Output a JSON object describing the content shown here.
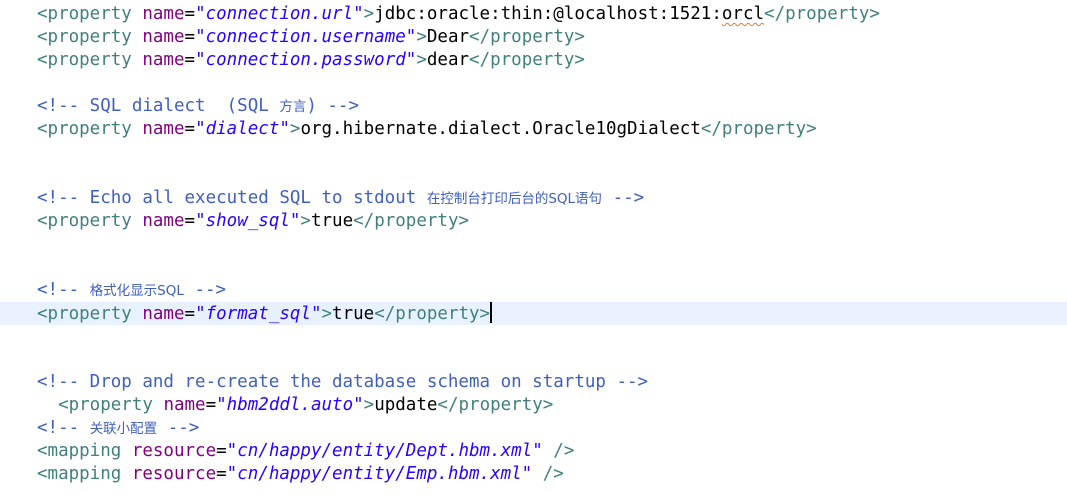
{
  "colors": {
    "tag": "#3f7f7f",
    "attribute": "#7f007f",
    "value": "#2a00ff",
    "text": "#000000",
    "comment": "#3f5fbf",
    "current_line": "#e8f2fe"
  },
  "lines": {
    "l1": {
      "open": "<property ",
      "attr": "name",
      "eq": "=",
      "value": "\"connection.url\"",
      "gt": ">",
      "text_a": "jdbc:oracle:thin:@localhost:1521:",
      "text_b": "orcl",
      "close": "</property>"
    },
    "l2": {
      "open": "<property ",
      "attr": "name",
      "eq": "=",
      "value": "\"connection.username\"",
      "gt": ">",
      "text": "Dear",
      "close": "</property>"
    },
    "l3": {
      "open": "<property ",
      "attr": "name",
      "eq": "=",
      "value": "\"connection.password\"",
      "gt": ">",
      "text": "dear",
      "close": "</property>"
    },
    "l4": {
      "comment": "<!-- SQL dialect  (SQL ",
      "cjk": "方言",
      "comment_end": ") -->"
    },
    "l5": {
      "open": "<property ",
      "attr": "name",
      "eq": "=",
      "value": "\"dialect\"",
      "gt": ">",
      "text": "org.hibernate.dialect.Oracle10gDialect",
      "close": "</property>"
    },
    "l6": {
      "comment": "<!-- Echo all executed SQL to stdout ",
      "cjk": "在控制台打印后台的SQL语句",
      "comment_end": " -->"
    },
    "l7": {
      "open": "<property ",
      "attr": "name",
      "eq": "=",
      "value": "\"show_sql\"",
      "gt": ">",
      "text": "true",
      "close": "</property>"
    },
    "l8": {
      "comment": "<!-- ",
      "cjk": "格式化显示SQL",
      "comment_end": " -->"
    },
    "l9": {
      "open": "<property ",
      "attr": "name",
      "eq": "=",
      "value": "\"format_sql\"",
      "gt": ">",
      "text": "true",
      "close": "</property>"
    },
    "l10": {
      "comment": "<!-- Drop and re-create the database schema on startup -->"
    },
    "l11": {
      "open": "  <property ",
      "attr": "name",
      "eq": "=",
      "value": "\"hbm2ddl.auto\"",
      "gt": ">",
      "text": "update",
      "close": "</property>"
    },
    "l12": {
      "comment": "<!-- ",
      "cjk": "关联小配置",
      "comment_end": " -->"
    },
    "l13": {
      "open": "<mapping ",
      "attr": "resource",
      "eq": "=",
      "value": "\"cn/happy/entity/Dept.hbm.xml\"",
      "close": " />"
    },
    "l14": {
      "open": "<mapping ",
      "attr": "resource",
      "eq": "=",
      "value": "\"cn/happy/entity/Emp.hbm.xml\"",
      "close": " />"
    }
  }
}
